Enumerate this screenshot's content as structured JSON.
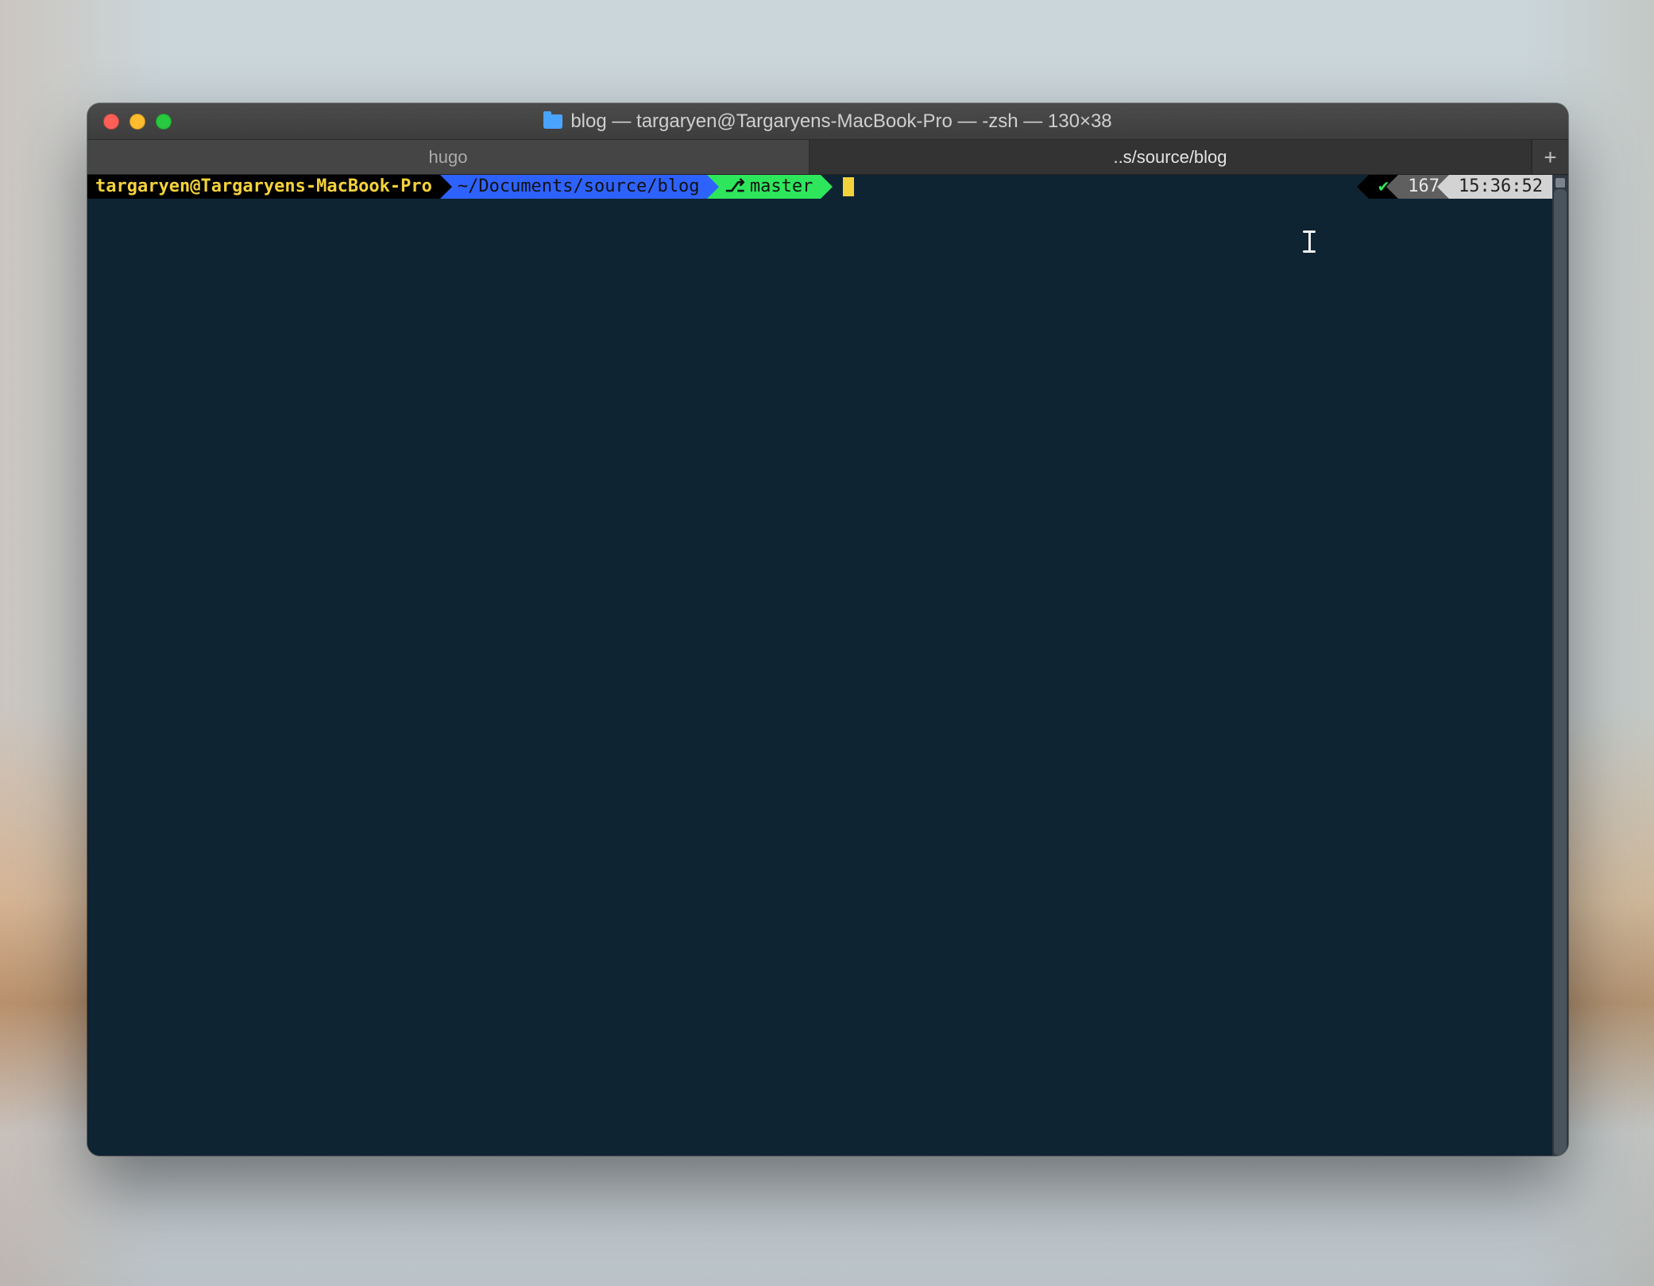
{
  "window": {
    "title": "blog — targaryen@Targaryens-MacBook-Pro — -zsh — 130×38"
  },
  "tabs": [
    {
      "label": "hugo",
      "active": false
    },
    {
      "label": "..s/source/blog",
      "active": true
    }
  ],
  "tab_plus_label": "+",
  "prompt": {
    "user_host": "targaryen@Targaryens-MacBook-Pro",
    "cwd": "~/Documents/source/blog",
    "branch_glyph": "⎇",
    "branch": "master"
  },
  "right_prompt": {
    "status_glyph": "✔",
    "history_number": "167",
    "time": "15:36:52"
  },
  "colors": {
    "host_bg": "#000000",
    "host_fg": "#f4d23c",
    "path_bg": "#2e62ff",
    "branch_bg": "#2ee65b",
    "term_bg": "#0f2433"
  }
}
